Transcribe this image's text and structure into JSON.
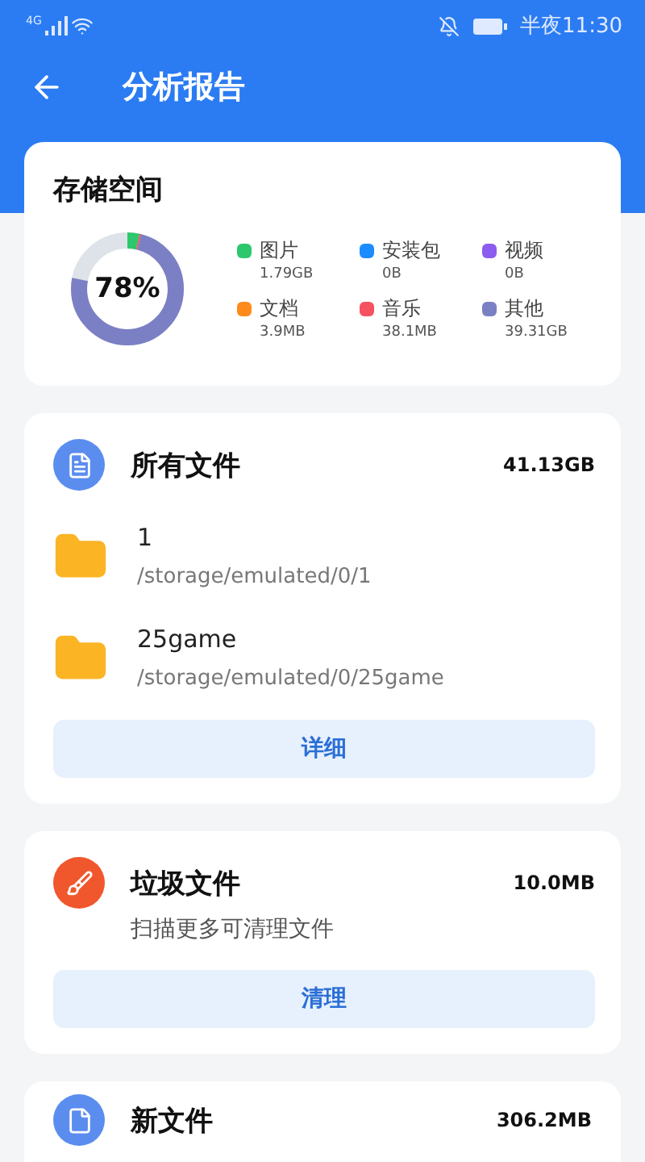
{
  "status_bar": {
    "time": "半夜11:30",
    "network": "4G"
  },
  "header": {
    "title": "分析报告"
  },
  "storage": {
    "title": "存储空间",
    "percent": "78%",
    "legend": [
      {
        "label": "图片",
        "size": "1.79GB",
        "color": "#2dc76d"
      },
      {
        "label": "安装包",
        "size": "0B",
        "color": "#1a8cff"
      },
      {
        "label": "视频",
        "size": "0B",
        "color": "#8c5cf0"
      },
      {
        "label": "文档",
        "size": "3.9MB",
        "color": "#ff8a1c"
      },
      {
        "label": "音乐",
        "size": "38.1MB",
        "color": "#f5515f"
      },
      {
        "label": "其他",
        "size": "39.31GB",
        "color": "#7b7fc4"
      }
    ]
  },
  "cards": [
    {
      "kind": "files",
      "title": "所有文件",
      "size": "41.13GB",
      "folders": [
        {
          "name": "1",
          "path": "/storage/emulated/0/1"
        },
        {
          "name": "25game",
          "path": "/storage/emulated/0/25game"
        }
      ],
      "button": "详细"
    },
    {
      "kind": "junk",
      "title": "垃圾文件",
      "size": "10.0MB",
      "subtitle": "扫描更多可清理文件",
      "button": "清理"
    },
    {
      "kind": "newfile",
      "title": "新文件",
      "size": "306.2MB"
    }
  ]
}
